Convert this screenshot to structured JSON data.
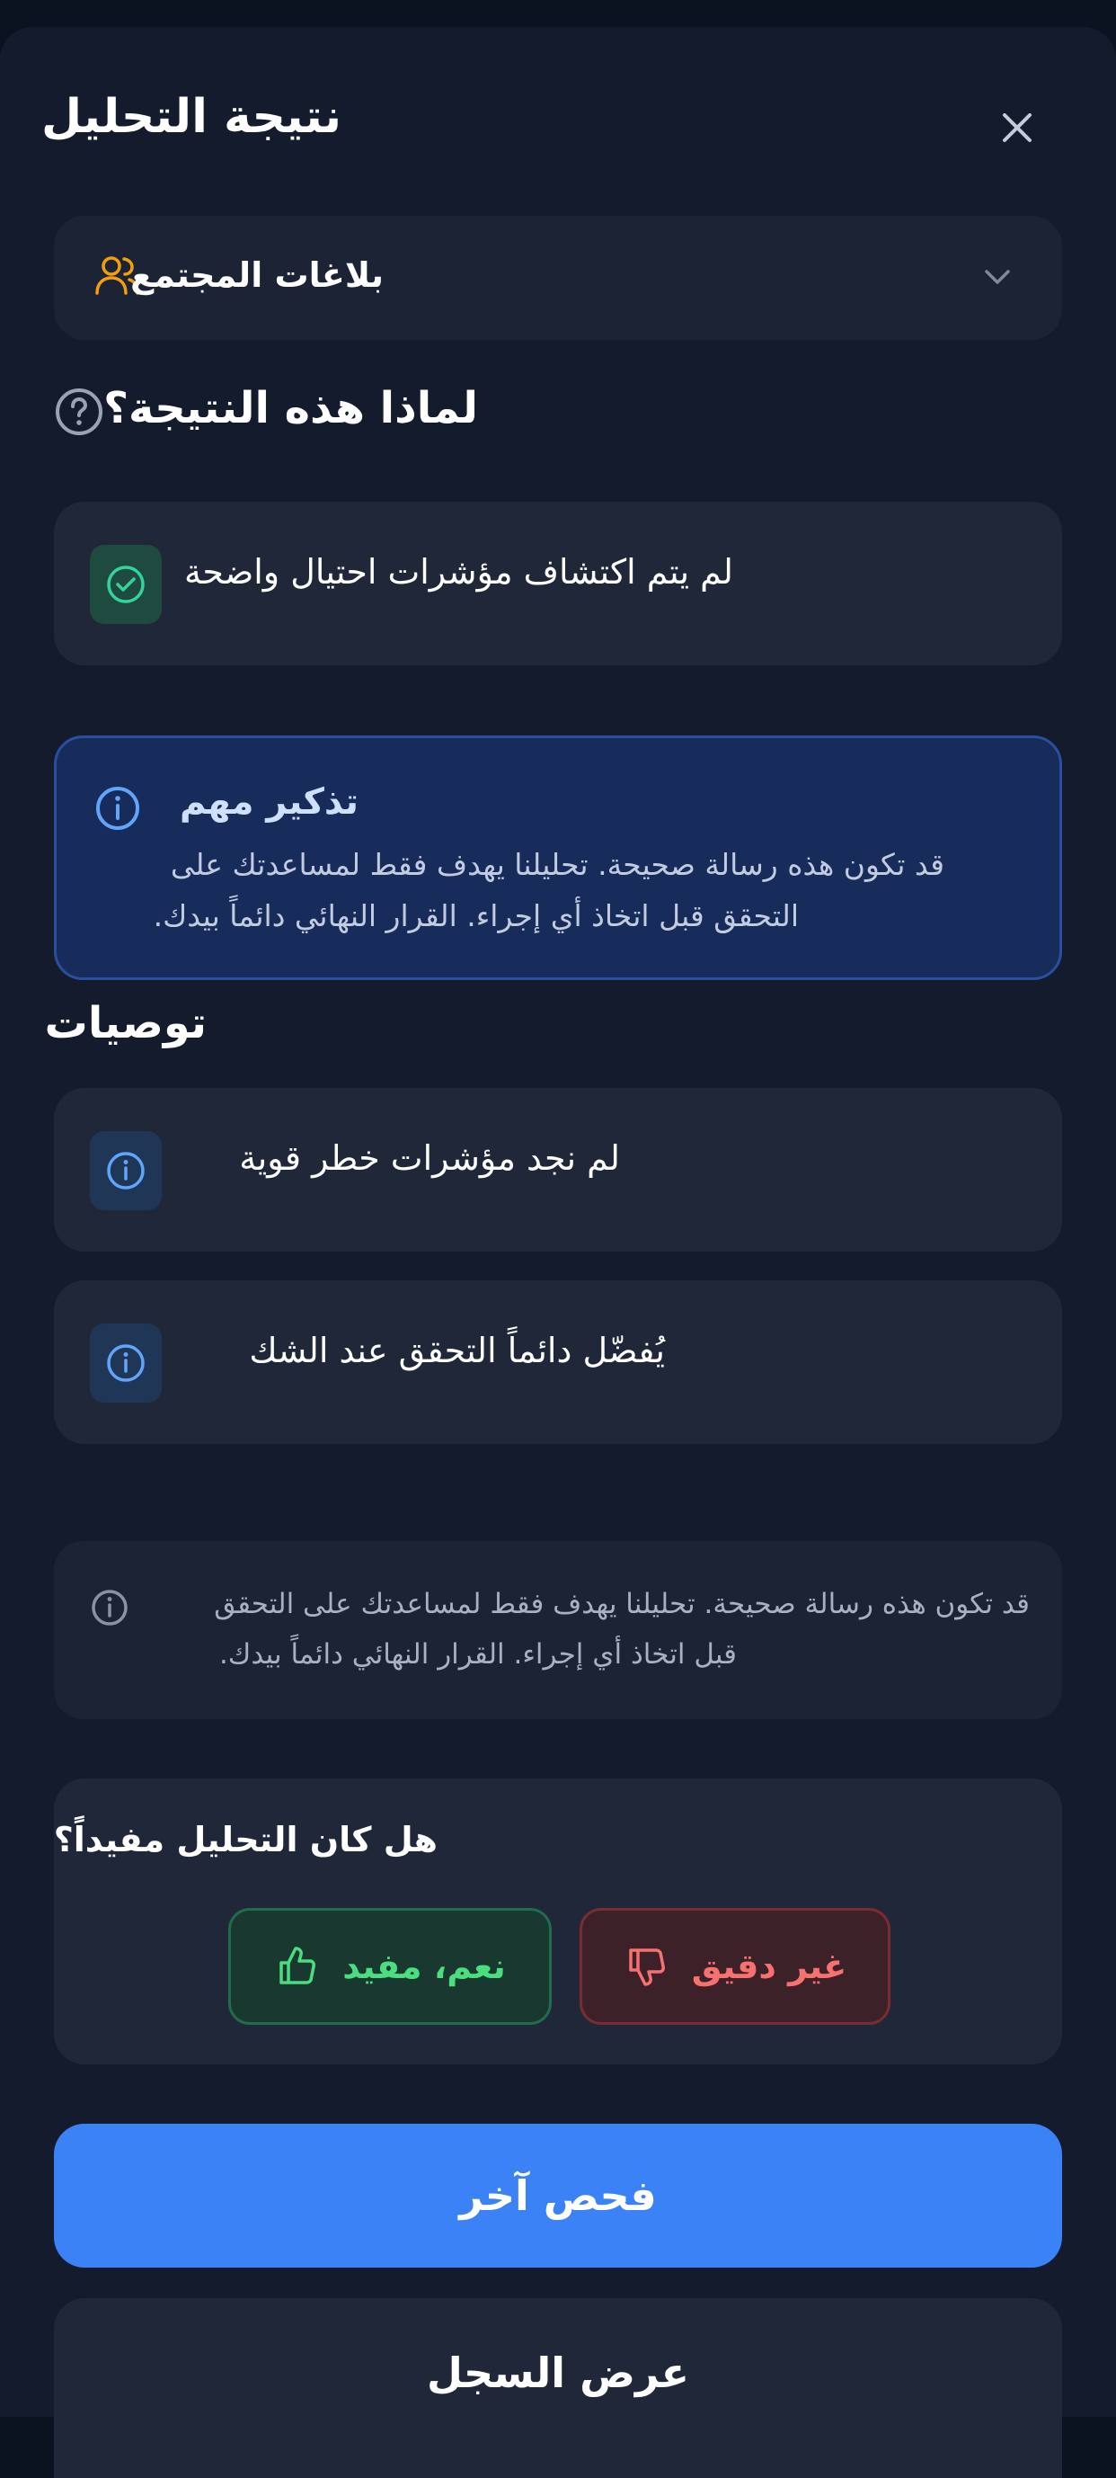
{
  "header": {
    "title": "نتيجة التحليل",
    "close_icon": "close-icon"
  },
  "source_selector": {
    "label": "بلاغات المجتمع",
    "icon": "users-icon",
    "chevron": "chevron-down-icon"
  },
  "why_section": {
    "heading": "لماذا هذه النتيجة؟",
    "help_icon": "question-circle-icon",
    "reasons": [
      {
        "text": "لم يتم اكتشاف مؤشرات احتيال واضحة",
        "icon": "check-circle-icon"
      }
    ]
  },
  "reminder": {
    "title": "تذكير مهم",
    "line1": "قد تكون هذه رسالة صحيحة. تحليلنا يهدف فقط لمساعدتك على",
    "line2": "التحقق قبل اتخاذ أي إجراء. القرار النهائي دائماً بيدك.",
    "icon": "info-circle-icon"
  },
  "recommendations": {
    "heading": "توصيات",
    "items": [
      {
        "text": "لم نجد مؤشرات خطر قوية",
        "icon": "info-circle-icon"
      },
      {
        "text": "يُفضّل دائماً التحقق عند الشك",
        "icon": "info-circle-icon"
      }
    ]
  },
  "disclaimer": {
    "line1": "قد تكون هذه رسالة صحيحة. تحليلنا يهدف فقط لمساعدتك على التحقق",
    "line2": "قبل اتخاذ أي إجراء. القرار النهائي دائماً بيدك.",
    "icon": "info-circle-icon"
  },
  "feedback": {
    "question": "هل كان التحليل مفيداً؟",
    "yes_label": "نعم، مفيد",
    "no_label": "غير دقيق",
    "yes_icon": "thumbs-up-icon",
    "no_icon": "thumbs-down-icon"
  },
  "actions": {
    "primary": "فحص آخر",
    "secondary": "عرض السجل"
  },
  "colors": {
    "background": "#131b2c",
    "card": "#1f2738",
    "accent": "#3b82f6",
    "success": "#4ade80",
    "danger": "#f87171",
    "warning_icon": "#f59e0b"
  }
}
